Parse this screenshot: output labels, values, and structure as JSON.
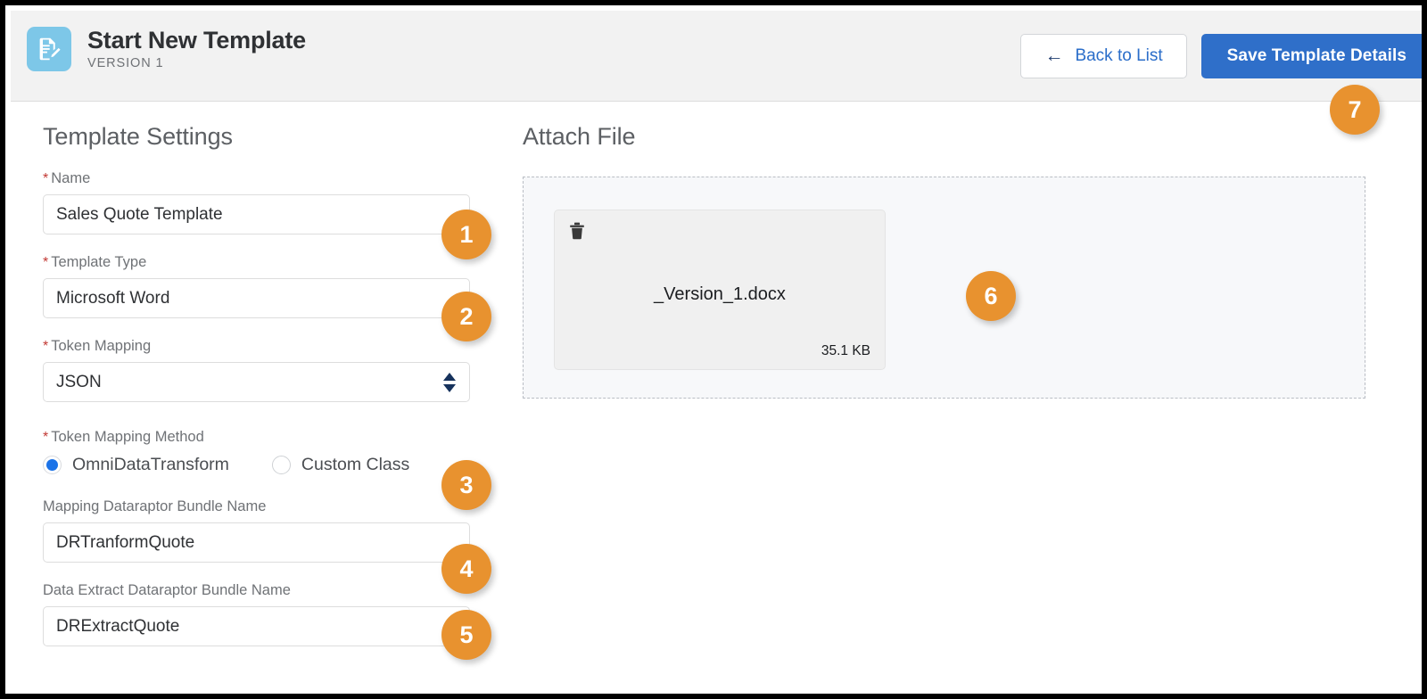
{
  "header": {
    "app_icon": "document-edit-icon",
    "title": "Start New Template",
    "subtitle": "VERSION 1",
    "back_button": "Back to List",
    "back_icon": "arrow-left-icon",
    "save_button": "Save Template Details",
    "bg_color": "#f2f2f2",
    "icon_bg_color": "#7dc7e8",
    "primary_button_color": "#2f6fc9",
    "secondary_button_text_color": "#2a6dc9"
  },
  "settings": {
    "heading": "Template Settings",
    "fields": [
      {
        "label": "Name",
        "required": true,
        "value": "Sales Quote Template",
        "type": "text"
      },
      {
        "label": "Template Type",
        "required": true,
        "value": "Microsoft Word",
        "type": "text"
      },
      {
        "label": "Token Mapping",
        "required": true,
        "value": "JSON",
        "type": "select"
      }
    ],
    "token_mapping_method": {
      "label": "Token Mapping Method",
      "required": true,
      "options": [
        {
          "label": "OmniDataTransform",
          "selected": true
        },
        {
          "label": "Custom Class",
          "selected": false
        }
      ],
      "selected_color": "#1b73e8"
    },
    "mapping_dataraptor": {
      "label": "Mapping Dataraptor Bundle Name",
      "required": false,
      "value": "DRTranformQuote"
    },
    "extract_dataraptor": {
      "label": "Data Extract Dataraptor Bundle Name",
      "required": false,
      "value": "DRExtractQuote"
    }
  },
  "attach": {
    "heading": "Attach File",
    "file": {
      "name": "_Version_1.docx",
      "size": "35.1 KB",
      "delete_icon": "trash-icon"
    }
  },
  "callouts": {
    "badge_color": "#e8922f",
    "items": [
      {
        "number": "1"
      },
      {
        "number": "2"
      },
      {
        "number": "3"
      },
      {
        "number": "4"
      },
      {
        "number": "5"
      },
      {
        "number": "6"
      },
      {
        "number": "7"
      }
    ]
  }
}
